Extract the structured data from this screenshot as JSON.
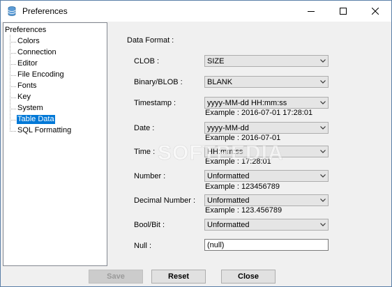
{
  "window": {
    "title": "Preferences"
  },
  "tree": {
    "root": "Preferences",
    "items": [
      "Colors",
      "Connection",
      "Editor",
      "File Encoding",
      "Fonts",
      "Key",
      "System",
      "Table Data",
      "SQL Formatting"
    ],
    "selected": "Table Data"
  },
  "panel": {
    "section_title": "Data Format :",
    "rows": {
      "clob": {
        "label": "CLOB :",
        "value": "SIZE"
      },
      "blob": {
        "label": "Binary/BLOB :",
        "value": "BLANK"
      },
      "timestamp": {
        "label": "Timestamp :",
        "value": "yyyy-MM-dd HH:mm:ss",
        "example": "Example : 2016-07-01 17:28:01"
      },
      "date": {
        "label": "Date :",
        "value": "yyyy-MM-dd",
        "example": "Example : 2016-07-01"
      },
      "time": {
        "label": "Time :",
        "value": "HH:mm:ss",
        "example": "Example : 17:28:01"
      },
      "number": {
        "label": "Number :",
        "value": "Unformatted",
        "example": "Example : 123456789"
      },
      "decimal": {
        "label": "Decimal Number :",
        "value": "Unformatted",
        "example": "Example : 123.456789"
      },
      "bool": {
        "label": "Bool/Bit :",
        "value": "Unformatted"
      },
      "null": {
        "label": "Null :",
        "value": "(null)"
      }
    }
  },
  "buttons": {
    "save": "Save",
    "reset": "Reset",
    "close": "Close"
  },
  "watermark": "SOFTPEDIA",
  "colors": {
    "selection": "#0078d7",
    "window_border": "#5a7fa8"
  }
}
